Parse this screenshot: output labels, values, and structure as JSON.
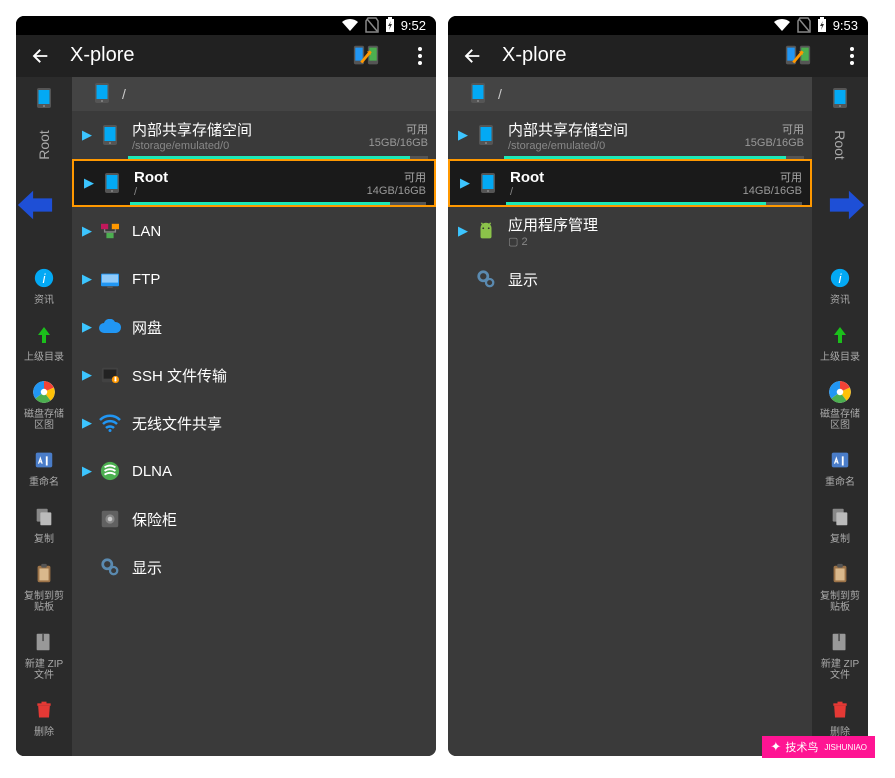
{
  "screens": [
    {
      "status_time": "9:52",
      "app_title": "X-plore",
      "crumb": "/",
      "side_tab": "Root",
      "arrow": "left",
      "buttons": [
        {
          "label": "资讯",
          "icon": "info",
          "bg": "#03a9f4"
        },
        {
          "label": "上级目录",
          "icon": "up",
          "bg": "#1bbf1b"
        },
        {
          "label": "磁盘存储区图",
          "icon": "disk",
          "bg": "#fff"
        },
        {
          "label": "重命名",
          "icon": "rename",
          "bg": "#3a87ff"
        },
        {
          "label": "复制",
          "icon": "copy",
          "bg": "#666"
        },
        {
          "label": "复制到剪贴板",
          "icon": "clip",
          "bg": "#7b5a3a"
        },
        {
          "label": "新建 ZIP 文件",
          "icon": "zip",
          "bg": "#666"
        },
        {
          "label": "删除",
          "icon": "trash",
          "bg": "#d33"
        }
      ],
      "entries": [
        {
          "type": "storage",
          "title": "内部共享存储空间",
          "sub": "/storage/emulated/0",
          "avail": "可用",
          "size": "15GB/16GB",
          "fill": 94
        },
        {
          "type": "root",
          "title": "Root",
          "sub": "/",
          "avail": "可用",
          "size": "14GB/16GB",
          "fill": 88,
          "selected": true
        },
        {
          "type": "item",
          "title": "LAN",
          "icon": "lan"
        },
        {
          "type": "item",
          "title": "FTP",
          "icon": "ftp"
        },
        {
          "type": "item",
          "title": "网盘",
          "icon": "cloud"
        },
        {
          "type": "item",
          "title": "SSH 文件传输",
          "icon": "ssh"
        },
        {
          "type": "item",
          "title": "无线文件共享",
          "icon": "wifi"
        },
        {
          "type": "item",
          "title": "DLNA",
          "icon": "dlna"
        },
        {
          "type": "item",
          "title": "保险柜",
          "icon": "safe",
          "no_chev": true
        },
        {
          "type": "item",
          "title": "显示",
          "icon": "gear",
          "no_chev": true
        }
      ]
    },
    {
      "status_time": "9:53",
      "app_title": "X-plore",
      "crumb": "/",
      "side_tab": "Root",
      "arrow": "right",
      "buttons": [
        {
          "label": "资讯",
          "icon": "info",
          "bg": "#03a9f4"
        },
        {
          "label": "上级目录",
          "icon": "up",
          "bg": "#1bbf1b"
        },
        {
          "label": "磁盘存储区图",
          "icon": "disk",
          "bg": "#fff"
        },
        {
          "label": "重命名",
          "icon": "rename",
          "bg": "#3a87ff"
        },
        {
          "label": "复制",
          "icon": "copy",
          "bg": "#666"
        },
        {
          "label": "复制到剪贴板",
          "icon": "clip",
          "bg": "#7b5a3a"
        },
        {
          "label": "新建 ZIP 文件",
          "icon": "zip",
          "bg": "#666"
        },
        {
          "label": "删除",
          "icon": "trash",
          "bg": "#d33"
        }
      ],
      "entries": [
        {
          "type": "storage",
          "title": "内部共享存储空间",
          "sub": "/storage/emulated/0",
          "avail": "可用",
          "size": "15GB/16GB",
          "fill": 94
        },
        {
          "type": "root",
          "title": "Root",
          "sub": "/",
          "avail": "可用",
          "size": "14GB/16GB",
          "fill": 88,
          "selected": true
        },
        {
          "type": "item",
          "title": "应用程序管理",
          "sub": "▢ 2",
          "icon": "android"
        },
        {
          "type": "item",
          "title": "显示",
          "icon": "gear",
          "no_chev": true
        }
      ]
    }
  ],
  "watermark": {
    "text": "技术鸟",
    "sub": "JISHUNIAO"
  }
}
